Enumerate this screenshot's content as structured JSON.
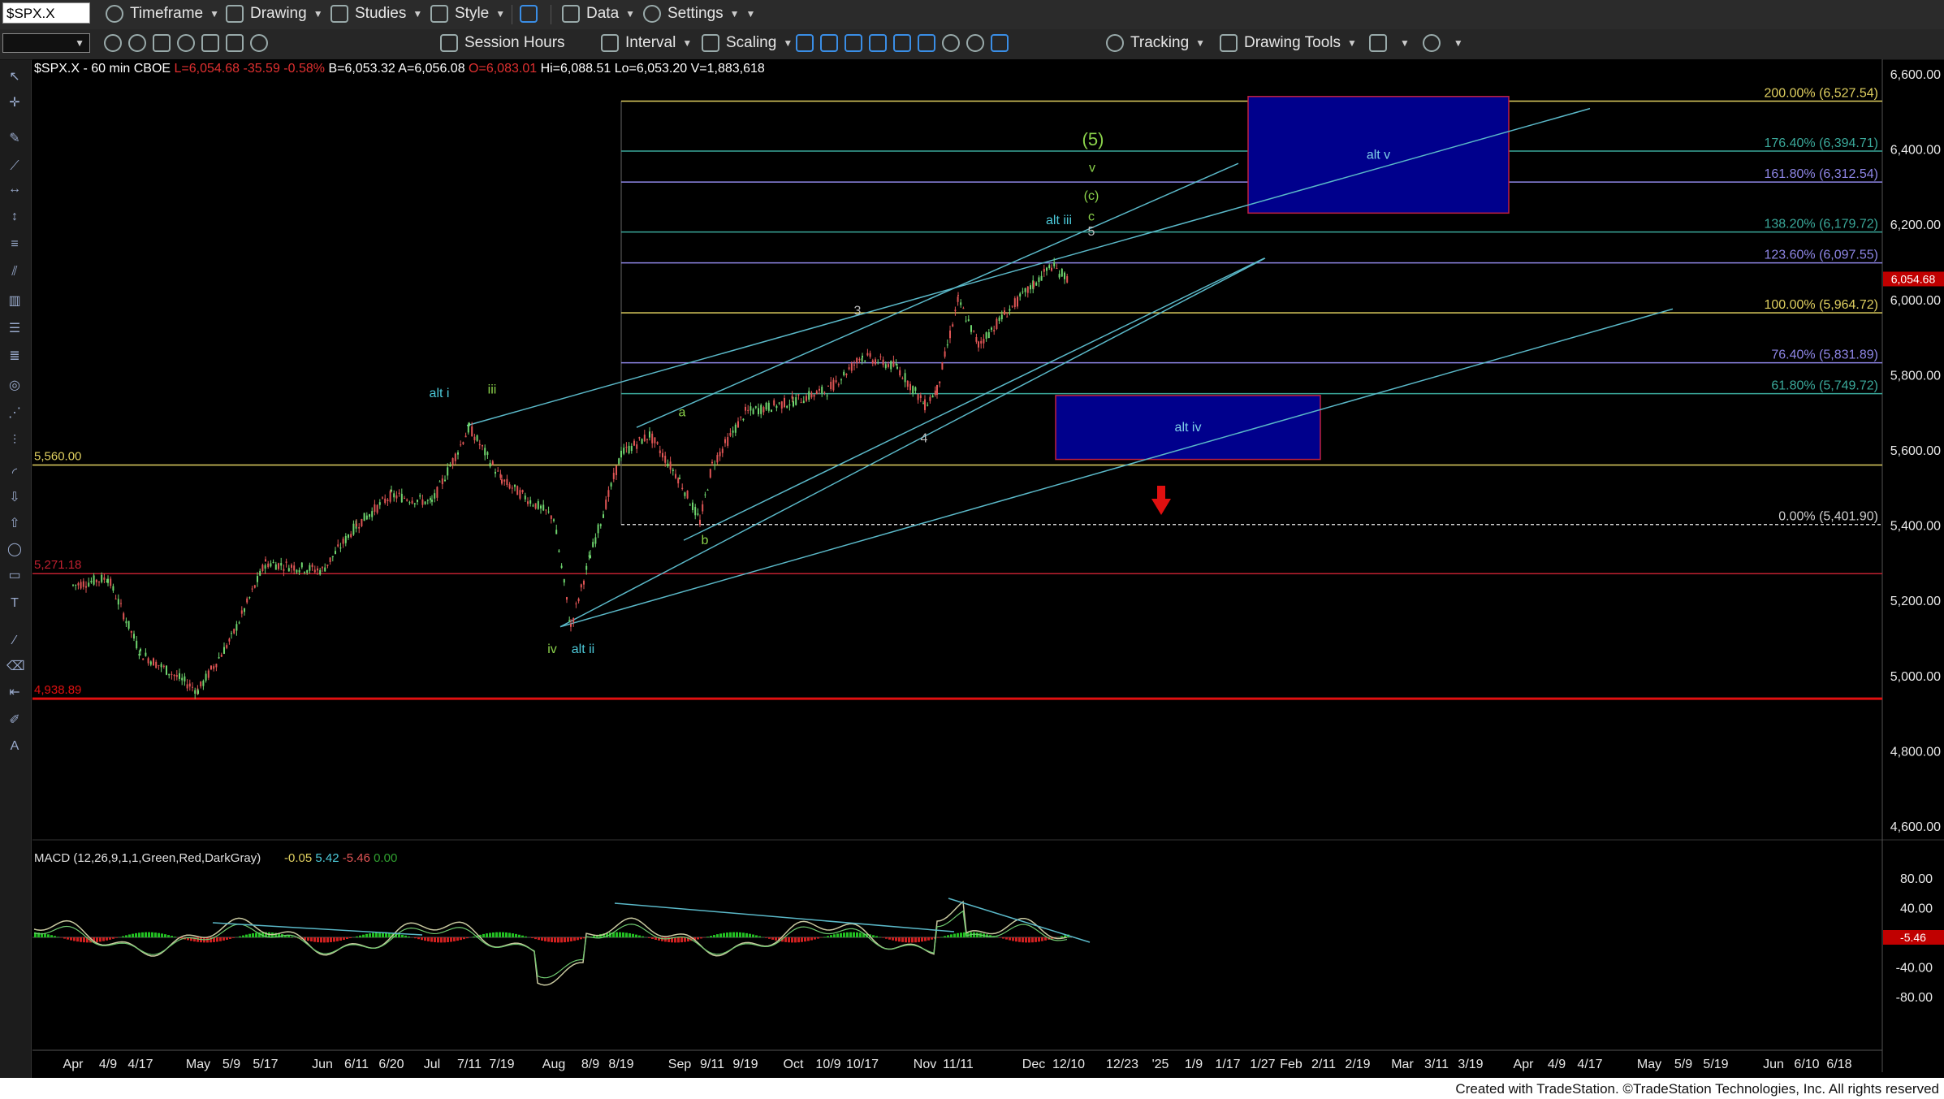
{
  "toolbar": {
    "symbol": "$SPX.X",
    "timeframe": "Timeframe",
    "drawing": "Drawing",
    "studies": "Studies",
    "style": "Style",
    "data": "Data",
    "settings": "Settings",
    "session_hours": "Session Hours",
    "interval": "Interval",
    "scaling": "Scaling",
    "tracking": "Tracking",
    "drawing_tools": "Drawing Tools"
  },
  "quote": {
    "name": "$SPX.X - 60 min  CBOE",
    "last": "L=6,054.68",
    "change": "-35.59",
    "pct": "-0.58%",
    "bid": "B=6,053.32",
    "ask": "A=6,056.08",
    "open": "O=6,083.01",
    "high": "Hi=6,088.51",
    "low": "Lo=6,053.20",
    "volume": "V=1,883,618"
  },
  "colors": {
    "up": "#6fd66f",
    "down": "#e05555",
    "fib_yellow": "#e0d060",
    "fib_teal": "#3aa89a",
    "fib_purple": "#8e86e6",
    "channel": "#5ab8c8",
    "box_fill": "#00008c",
    "box_border": "#c02040",
    "red": "#e01010"
  },
  "chart_data": {
    "type": "candlestick",
    "title": "$SPX.X - 60 min",
    "y_range": [
      4400,
      6650
    ],
    "y_ticks": [
      "6,600.00",
      "6,400.00",
      "6,200.00",
      "6,000.00",
      "5,800.00",
      "5,600.00",
      "5,400.00",
      "5,200.00",
      "5,000.00",
      "4,800.00",
      "4,600.00"
    ],
    "x_ticks": [
      "Apr",
      "4/9",
      "4/17",
      "May",
      "5/9",
      "5/17",
      "Jun",
      "6/11",
      "6/20",
      "Jul",
      "7/11",
      "7/19",
      "Aug",
      "8/9",
      "8/19",
      "Sep",
      "9/11",
      "9/19",
      "Oct",
      "10/9",
      "10/17",
      "Nov",
      "11/11",
      "Dec",
      "12/10",
      "12/23",
      "'25",
      "1/9",
      "1/17",
      "1/27",
      "Feb",
      "2/11",
      "2/19",
      "Mar",
      "3/11",
      "3/19",
      "Apr",
      "4/9",
      "4/17",
      "May",
      "5/9",
      "5/19",
      "Jun",
      "6/10",
      "6/18"
    ],
    "price_path": [
      [
        "Apr",
        5240
      ],
      [
        "4/9",
        5260
      ],
      [
        "4/17",
        5060
      ],
      [
        "May",
        4960
      ],
      [
        "5/9",
        5100
      ],
      [
        "5/17",
        5300
      ],
      [
        "Jun",
        5280
      ],
      [
        "6/11",
        5400
      ],
      [
        "6/20",
        5480
      ],
      [
        "Jul",
        5460
      ],
      [
        "7/11",
        5660
      ],
      [
        "7/19",
        5520
      ],
      [
        "Aug",
        5420
      ],
      [
        "8/5",
        5130
      ],
      [
        "8/9",
        5320
      ],
      [
        "8/19",
        5590
      ],
      [
        "8/27",
        5640
      ],
      [
        "Sep",
        5520
      ],
      [
        "9/6",
        5410
      ],
      [
        "9/11",
        5560
      ],
      [
        "9/19",
        5700
      ],
      [
        "Oct",
        5730
      ],
      [
        "10/9",
        5760
      ],
      [
        "10/17",
        5850
      ],
      [
        "10/24",
        5820
      ],
      [
        "Nov",
        5720
      ],
      [
        "11/5",
        5760
      ],
      [
        "11/11",
        6000
      ],
      [
        "11/15",
        5880
      ],
      [
        "11/22",
        5960
      ],
      [
        "Dec",
        6040
      ],
      [
        "12/6",
        6090
      ],
      [
        "12/10",
        6054.68
      ]
    ],
    "last_price": "6,054.68",
    "fib_levels": [
      {
        "label": "200.00% (6,527.54)",
        "value": 6527.54
      },
      {
        "label": "176.40% (6,394.71)",
        "value": 6394.71
      },
      {
        "label": "161.80% (6,312.54)",
        "value": 6312.54
      },
      {
        "label": "138.20% (6,179.72)",
        "value": 6179.72
      },
      {
        "label": "123.60% (6,097.55)",
        "value": 6097.55
      },
      {
        "label": "100.00% (5,964.72)",
        "value": 5964.72
      },
      {
        "label": "76.40% (5,831.89)",
        "value": 5831.89
      },
      {
        "label": "61.80% (5,749.72)",
        "value": 5749.72
      },
      {
        "label": "0.00% (5,401.90)",
        "value": 5401.9
      }
    ],
    "horizontal_lines": [
      {
        "label": "5,560.00",
        "value": 5560
      },
      {
        "label": "5,271.18",
        "value": 5271.18
      },
      {
        "label": "4,938.89",
        "value": 4938.89
      }
    ],
    "boxes": [
      {
        "label": "alt v",
        "x0": "1/9",
        "x1": "3/19",
        "y0": 6230,
        "y1": 6540
      },
      {
        "label": "alt iv",
        "x0": "12/10",
        "x1": "Feb",
        "y0": 5575,
        "y1": 5745
      }
    ],
    "wave_labels": [
      {
        "text": "alt i",
        "x": "7/11",
        "y": 5740
      },
      {
        "text": "iii",
        "x": "7/19",
        "y": 5750
      },
      {
        "text": "iv",
        "x": "Aug",
        "y": 5060
      },
      {
        "text": "alt ii",
        "x": "8/9",
        "y": 5060
      },
      {
        "text": "a",
        "x": "8/27",
        "y": 5690
      },
      {
        "text": "b",
        "x": "9/11",
        "y": 5350
      },
      {
        "text": "3",
        "x": "10/9",
        "y": 5960
      },
      {
        "text": "4",
        "x": "11/5",
        "y": 5620
      },
      {
        "text": "alt iii",
        "x": "Dec",
        "y": 6200
      },
      {
        "text": "5",
        "x": "12/10",
        "y": 6170
      },
      {
        "text": "c",
        "x": "12/10",
        "y": 6210
      },
      {
        "text": "(c)",
        "x": "12/10",
        "y": 6265
      },
      {
        "text": "v",
        "x": "12/10",
        "y": 6340
      },
      {
        "text": "(5)",
        "x": "12/10",
        "y": 6410
      }
    ],
    "macd": {
      "label": "MACD (12,26,9,1,1,Green,Red,DarkGray)",
      "values": [
        "-0.05",
        "5.42",
        "-5.46",
        "0.00"
      ],
      "y_range": [
        -90,
        100
      ],
      "y_ticks": [
        "80.00",
        "40.00",
        "-40.00",
        "-80.00"
      ],
      "last": "-5.46"
    }
  },
  "footer": "Created with TradeStation. ©TradeStation Technologies, Inc. All rights reserved"
}
